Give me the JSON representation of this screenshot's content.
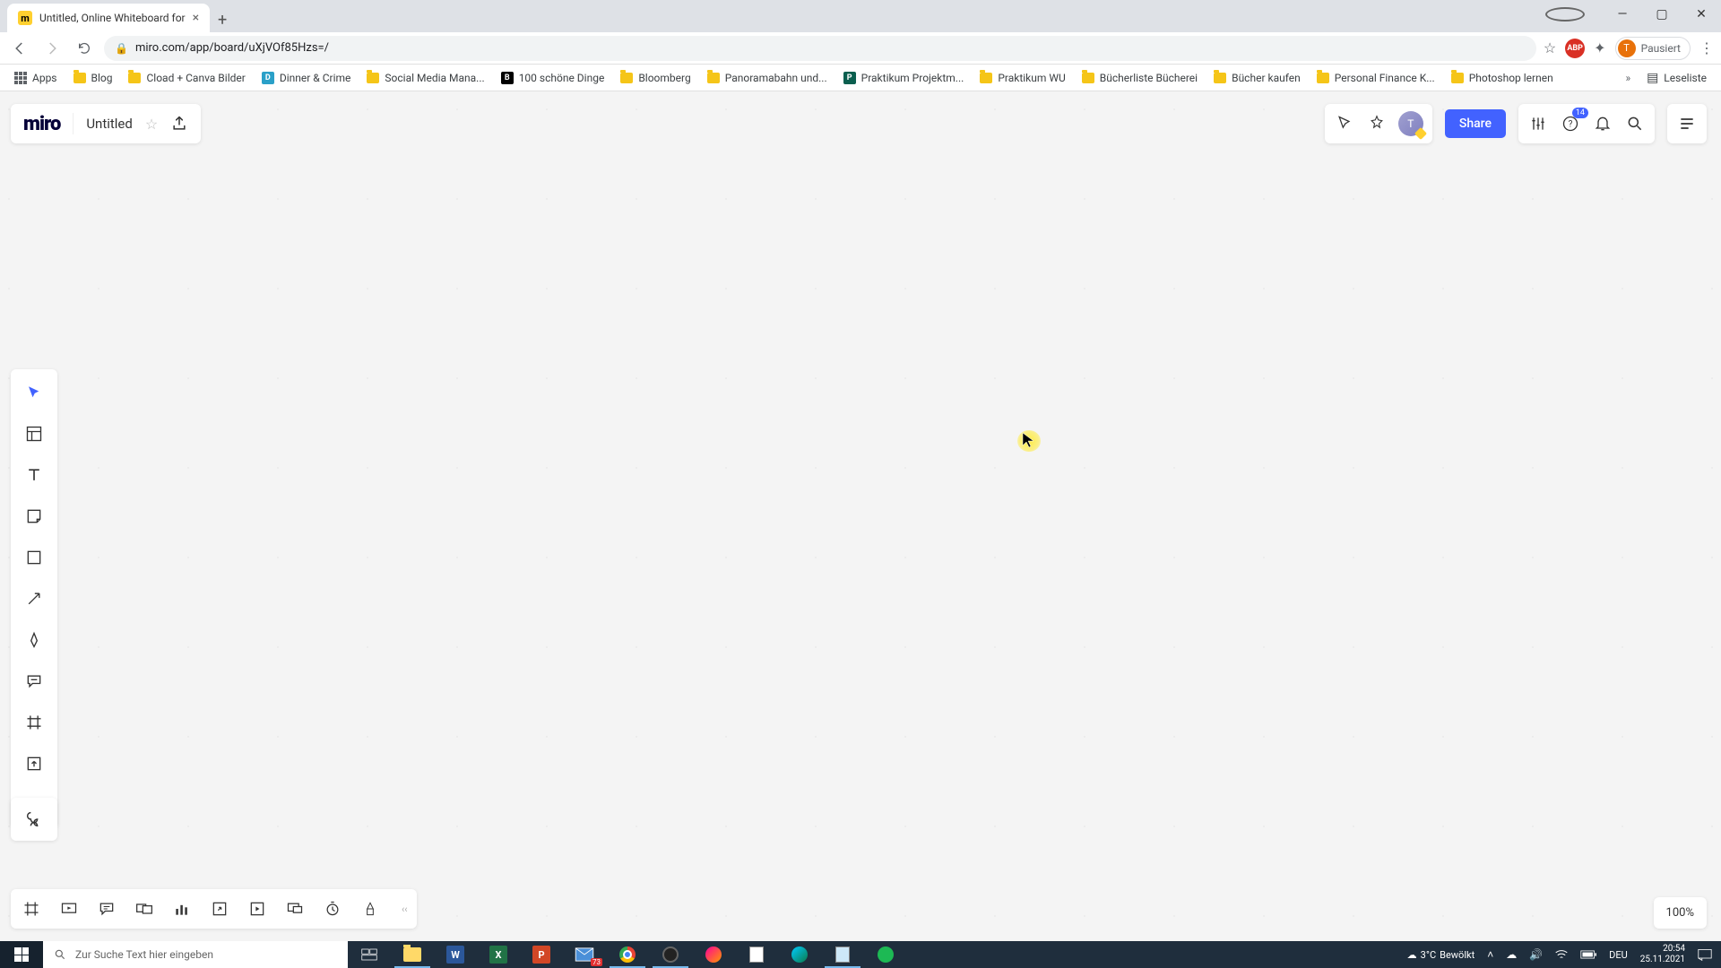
{
  "browser": {
    "tab_title": "Untitled, Online Whiteboard for",
    "url": "miro.com/app/board/uXjVOf85Hzs=/",
    "profile_status": "Pausiert",
    "profile_initial": "T",
    "apps_label": "Apps",
    "bookmarks": [
      {
        "label": "Blog",
        "type": "folder"
      },
      {
        "label": "Cload + Canva Bilder",
        "type": "folder"
      },
      {
        "label": "Dinner & Crime",
        "type": "site",
        "color": "#2aa0c8"
      },
      {
        "label": "Social Media Mana...",
        "type": "folder"
      },
      {
        "label": "100 schöne Dinge",
        "type": "site",
        "color": "#000"
      },
      {
        "label": "Bloomberg",
        "type": "folder"
      },
      {
        "label": "Panoramabahn und...",
        "type": "folder"
      },
      {
        "label": "Praktikum Projektm...",
        "type": "site",
        "color": "#0b5f4f"
      },
      {
        "label": "Praktikum WU",
        "type": "folder"
      },
      {
        "label": "Bücherliste Bücherei",
        "type": "folder"
      },
      {
        "label": "Bücher kaufen",
        "type": "folder"
      },
      {
        "label": "Personal Finance K...",
        "type": "folder"
      },
      {
        "label": "Photoshop lernen",
        "type": "folder"
      }
    ],
    "reading_list": "Leseliste"
  },
  "miro": {
    "logo": "miro",
    "board_title": "Untitled",
    "share_label": "Share",
    "notification_count": "14",
    "user_initial": "T",
    "zoom": "100%"
  },
  "taskbar": {
    "search_placeholder": "Zur Suche Text hier eingeben",
    "weather_temp": "3°C",
    "weather_desc": "Bewölkt",
    "lang": "DEU",
    "time": "20:54",
    "date": "25.11.2021",
    "mail_badge": "73"
  }
}
